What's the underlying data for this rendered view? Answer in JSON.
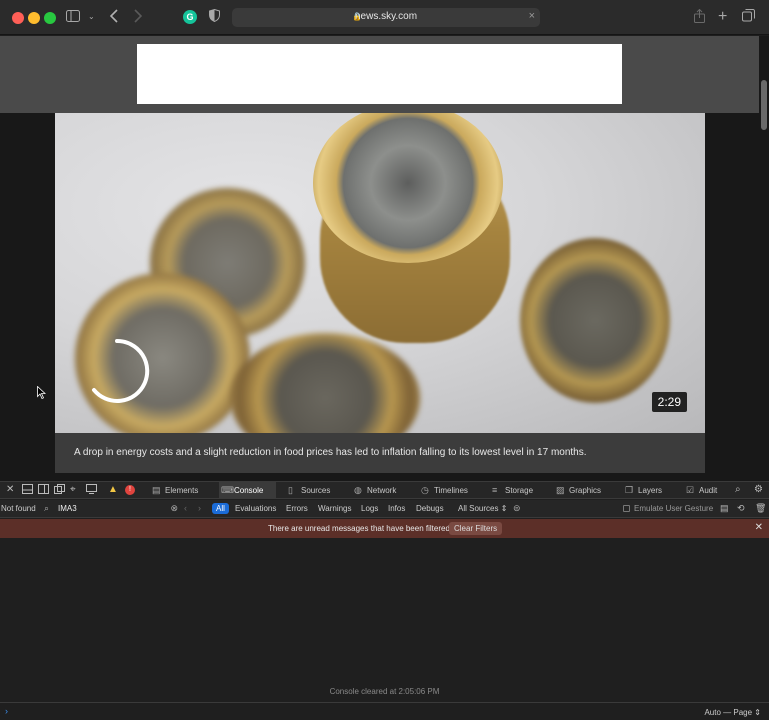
{
  "browser": {
    "url": "news.sky.com",
    "colors": {
      "close": "#fe5f57",
      "minimize": "#febc2e",
      "maximize": "#28c840"
    }
  },
  "article": {
    "video_duration": "2:29",
    "caption": "A drop in energy costs and a slight reduction in food prices has led to inflation falling to its lowest level in 17 months."
  },
  "devtools": {
    "error_count": "!",
    "tabs": [
      {
        "label": "Elements",
        "icon": "elements-icon"
      },
      {
        "label": "Console",
        "icon": "console-icon",
        "active": true
      },
      {
        "label": "Sources",
        "icon": "sources-icon"
      },
      {
        "label": "Network",
        "icon": "network-icon"
      },
      {
        "label": "Timelines",
        "icon": "timelines-icon"
      },
      {
        "label": "Storage",
        "icon": "storage-icon"
      },
      {
        "label": "Graphics",
        "icon": "graphics-icon"
      },
      {
        "label": "Layers",
        "icon": "layers-icon"
      },
      {
        "label": "Audit",
        "icon": "audit-icon"
      }
    ],
    "filter": {
      "not_found": "Not found",
      "query": "IMA3"
    },
    "levels": [
      "All",
      "Evaluations",
      "Errors",
      "Warnings",
      "Logs",
      "Infos",
      "Debugs"
    ],
    "sources_select": "All Sources",
    "emulate_gesture": "Emulate User Gesture",
    "banner": {
      "message": "There are unread messages that have been filtered",
      "button": "Clear Filters"
    },
    "cleared_message": "Console cleared at 2:05:06 PM",
    "page_select": "Auto — Page"
  }
}
